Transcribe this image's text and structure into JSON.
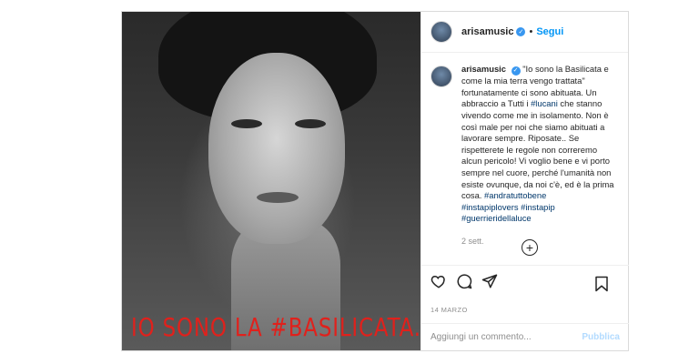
{
  "post": {
    "username": "arisamusic",
    "separator": "•",
    "follow_label": "Segui",
    "verified_glyph": "✓",
    "image_overlay_text": "IO SONO LA #BASILICATA.",
    "caption": {
      "username": "arisamusic",
      "text_1": "\"Io sono la Basilicata e come la mia terra vengo trattata\" fortunatamente ci sono abituata. Un abbraccio a Tutti i ",
      "tag_lucani": "#lucani",
      "text_2": " che stanno vivendo come me in isolamento. Non è così male per noi che siamo abituati a lavorare sempre. Riposate.. Se rispetterete le regole non correremo alcun pericolo! Vi voglio bene e vi porto sempre nel cuore, perché l'umanità non esiste ovunque, da noi c'è, ed è la prima cosa. ",
      "tag_1": "#andratuttobene",
      "tag_2": "#instapiplovers",
      "tag_3": "#instapip",
      "tag_4": "#guerrieridellaluce",
      "age": "2 sett."
    },
    "load_more_glyph": "+",
    "date": "14 MARZO",
    "comment_placeholder": "Aggiungi un commento...",
    "publish_label": "Pubblica"
  },
  "icons": {
    "like": "heart-icon",
    "comment": "comment-icon",
    "share": "paper-plane-icon",
    "save": "bookmark-icon"
  },
  "colors": {
    "link": "#0095f6",
    "overlay_red": "#e0211c",
    "hashtag": "#00376b",
    "muted": "#8e8e8e"
  }
}
